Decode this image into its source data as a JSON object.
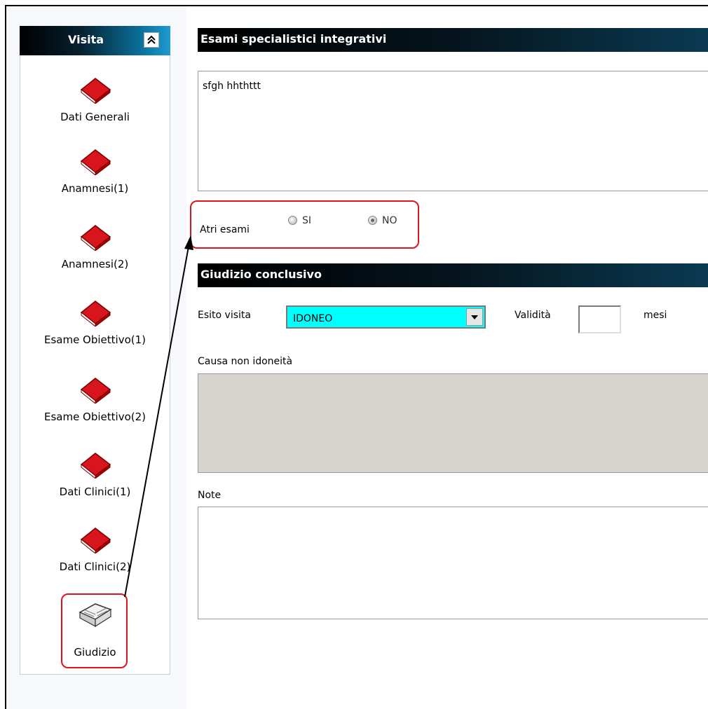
{
  "sidebar": {
    "title": "Visita",
    "items": [
      {
        "label": "Dati Generali",
        "icon": "red-book-icon"
      },
      {
        "label": "Anamnesi(1)",
        "icon": "red-book-icon"
      },
      {
        "label": "Anamnesi(2)",
        "icon": "red-book-icon"
      },
      {
        "label": "Esame Obiettivo(1)",
        "icon": "red-book-icon"
      },
      {
        "label": "Esame Obiettivo(2)",
        "icon": "red-book-icon"
      },
      {
        "label": "Dati Clinici(1)",
        "icon": "red-book-icon"
      },
      {
        "label": "Dati Clinici(2)",
        "icon": "red-book-icon"
      },
      {
        "label": "Giudizio",
        "icon": "open-book-icon"
      }
    ]
  },
  "esami": {
    "title": "Esami specialistici integrativi",
    "text": "sfgh hhthttt",
    "altri_label": "Atri esami",
    "opt_si": "SI",
    "opt_no": "NO",
    "selected": "NO"
  },
  "giudizio": {
    "title": "Giudizio conclusivo",
    "esito_label": "Esito visita",
    "esito_value": "IDONEO",
    "validita_label": "Validità",
    "validita_value": "",
    "mesi_label": "mesi",
    "causa_label": "Causa non idoneità",
    "note_label": "Note"
  },
  "colors": {
    "highlight": "#e0141e",
    "select_bg": "#00ffff",
    "book_red": "#d8141c"
  }
}
